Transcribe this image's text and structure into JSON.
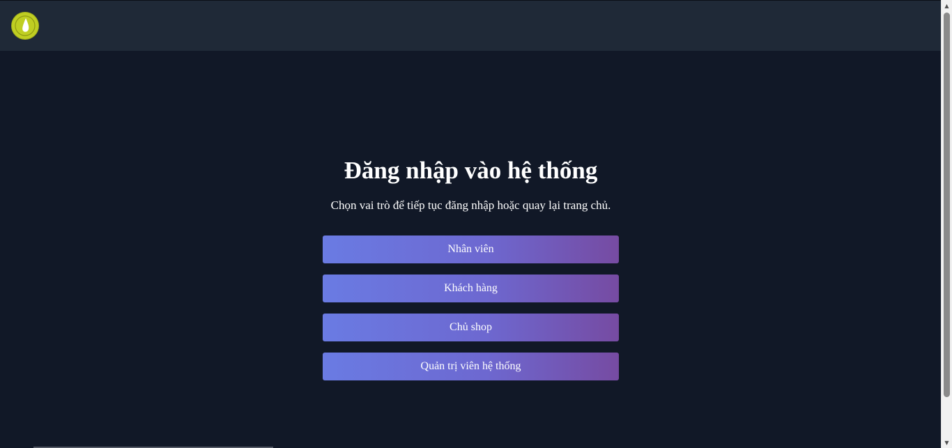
{
  "header": {
    "logo_icon": "water-drop-icon",
    "logo_color": "#bfce22"
  },
  "main": {
    "title": "Đăng nhập vào hệ thống",
    "subtitle": "Chọn vai trò để tiếp tục đăng nhập hoặc quay lại trang chủ.",
    "roles": [
      {
        "label": "Nhân viên"
      },
      {
        "label": "Khách hàng"
      },
      {
        "label": "Chủ shop"
      },
      {
        "label": "Quản trị viên hệ thống"
      }
    ]
  },
  "colors": {
    "background": "#111827",
    "header_background": "#1f2937",
    "button_gradient_start": "#667eea",
    "button_gradient_end": "#764ba2",
    "text": "#ffffff"
  }
}
